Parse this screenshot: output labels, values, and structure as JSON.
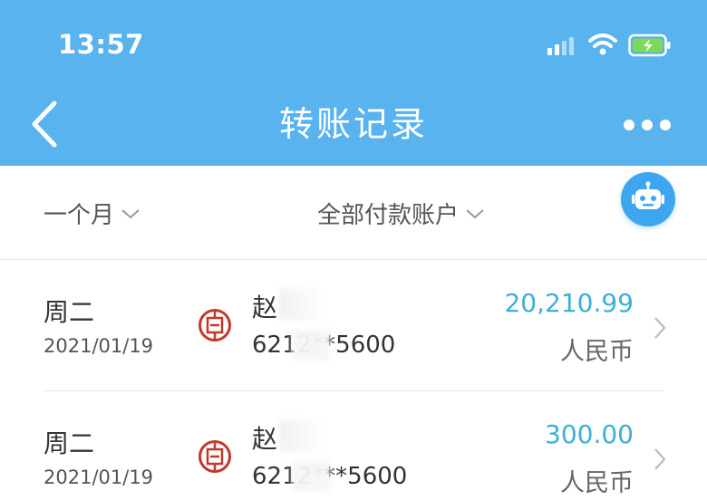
{
  "status_bar": {
    "time": "13:57"
  },
  "header": {
    "title": "转账记录"
  },
  "filters": {
    "period": "一个月",
    "account": "全部付款账户"
  },
  "records": [
    {
      "weekday": "周二",
      "date": "2021/01/19",
      "name": "赵",
      "account": "6212**5600",
      "amount": "20,210.99",
      "currency": "人民币"
    },
    {
      "weekday": "周二",
      "date": "2021/01/19",
      "name": "赵",
      "account": "6212***5600",
      "amount": "300.00",
      "currency": "人民币"
    }
  ],
  "colors": {
    "header": "#58b3ee",
    "amount": "#3dafd8",
    "bank_logo": "#c0392b",
    "robot": "#3ea6ee"
  },
  "icons": [
    "back-arrow-icon",
    "more-icon",
    "robot-icon",
    "chevron-down-icon",
    "bank-logo-icon",
    "chevron-right-icon",
    "signal-icon",
    "wifi-icon",
    "battery-icon"
  ]
}
